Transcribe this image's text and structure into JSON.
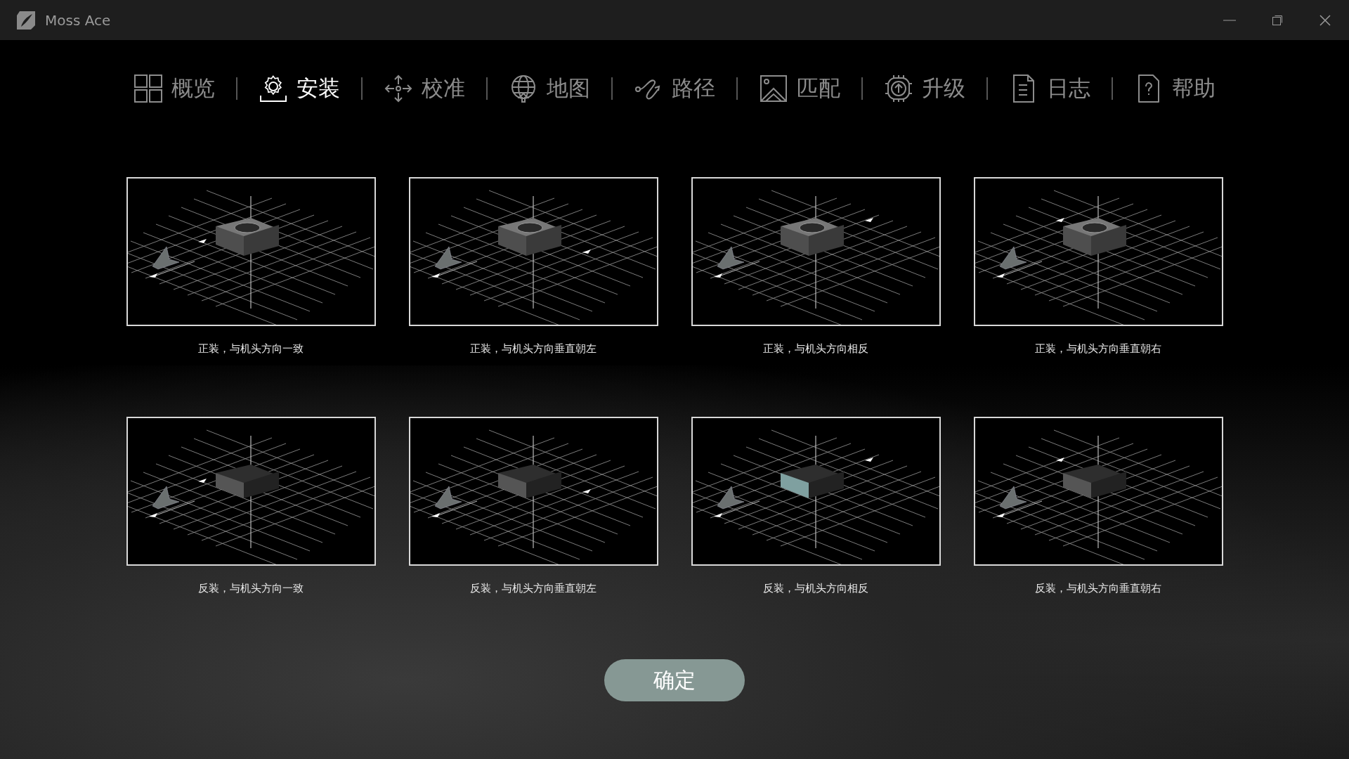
{
  "window": {
    "title": "Moss Ace"
  },
  "tabs": [
    {
      "label": "概览",
      "selected": false
    },
    {
      "label": "安装",
      "selected": true
    },
    {
      "label": "校准",
      "selected": false
    },
    {
      "label": "地图",
      "selected": false
    },
    {
      "label": "路径",
      "selected": false
    },
    {
      "label": "匹配",
      "selected": false
    },
    {
      "label": "升级",
      "selected": false
    },
    {
      "label": "日志",
      "selected": false
    },
    {
      "label": "帮助",
      "selected": false
    }
  ],
  "mount_options": [
    {
      "label": "正装，与机头方向一致",
      "kind": "upright"
    },
    {
      "label": "正装，与机头方向垂直朝左",
      "kind": "upright"
    },
    {
      "label": "正装，与机头方向相反",
      "kind": "upright"
    },
    {
      "label": "正装，与机头方向垂直朝右",
      "kind": "upright"
    },
    {
      "label": "反装，与机头方向一致",
      "kind": "inverted"
    },
    {
      "label": "反装，与机头方向垂直朝左",
      "kind": "inverted"
    },
    {
      "label": "反装，与机头方向相反",
      "kind": "inverted"
    },
    {
      "label": "反装，与机头方向垂直朝右",
      "kind": "inverted"
    }
  ],
  "confirm_button": "确定"
}
